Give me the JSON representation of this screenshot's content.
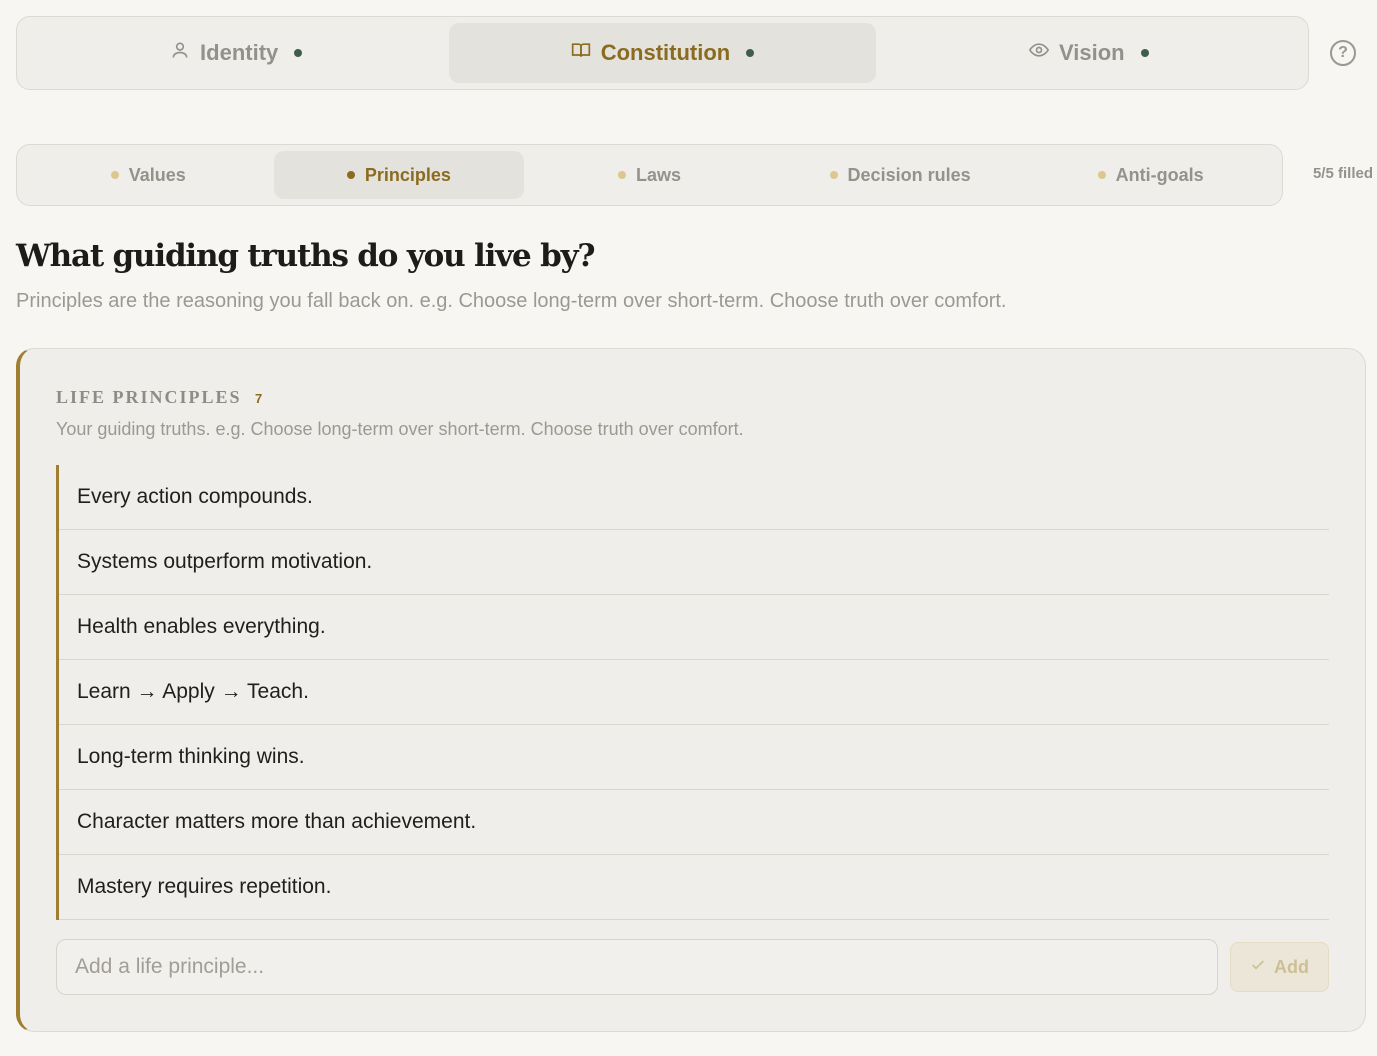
{
  "top_tabs": [
    {
      "label": "Identity",
      "icon": "person-icon",
      "active": false
    },
    {
      "label": "Constitution",
      "icon": "book-icon",
      "active": true
    },
    {
      "label": "Vision",
      "icon": "eye-icon",
      "active": false
    }
  ],
  "help_label": "?",
  "sub_tabs": [
    {
      "label": "Values",
      "active": false
    },
    {
      "label": "Principles",
      "active": true
    },
    {
      "label": "Laws",
      "active": false
    },
    {
      "label": "Decision rules",
      "active": false
    },
    {
      "label": "Anti-goals",
      "active": false
    }
  ],
  "filled_status": "5/5 filled",
  "heading": "What guiding truths do you live by?",
  "subheading": "Principles are the reasoning you fall back on. e.g. Choose long-term over short-term. Choose truth over comfort.",
  "card": {
    "title": "LIFE PRINCIPLES",
    "count": "7",
    "description": "Your guiding truths. e.g. Choose long-term over short-term. Choose truth over comfort.",
    "items": [
      "Every action compounds.",
      "Systems outperform motivation.",
      "Health enables everything.",
      "Learn → Apply → Teach.",
      "Long-term thinking wins.",
      "Character matters more than achievement.",
      "Mastery requires repetition."
    ],
    "input_placeholder": "Add a life principle...",
    "add_label": "Add"
  },
  "colors": {
    "accent": "#8b6b1f",
    "status_dot": "#3f5e4a",
    "background": "#f7f6f3"
  }
}
